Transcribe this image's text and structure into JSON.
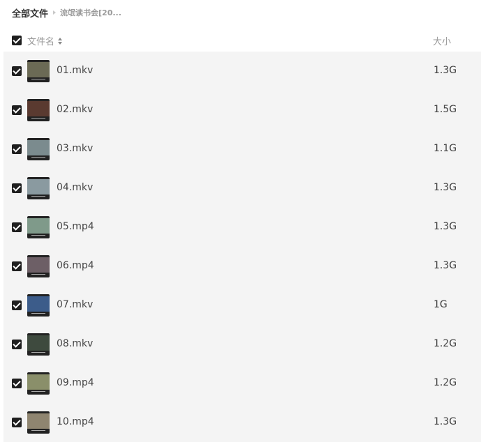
{
  "breadcrumb": {
    "root": "全部文件",
    "current": "流氓读书会[20..."
  },
  "header": {
    "name_label": "文件名",
    "size_label": "大小",
    "all_checked": true
  },
  "files": [
    {
      "name": "01.mkv",
      "size": "1.3G",
      "checked": true,
      "thumb_color": "#6b6a55"
    },
    {
      "name": "02.mkv",
      "size": "1.5G",
      "checked": true,
      "thumb_color": "#5a3a30"
    },
    {
      "name": "03.mkv",
      "size": "1.1G",
      "checked": true,
      "thumb_color": "#7b8b8e"
    },
    {
      "name": "04.mkv",
      "size": "1.3G",
      "checked": true,
      "thumb_color": "#8a9aa0"
    },
    {
      "name": "05.mp4",
      "size": "1.3G",
      "checked": true,
      "thumb_color": "#7f9a8a"
    },
    {
      "name": "06.mp4",
      "size": "1.3G",
      "checked": true,
      "thumb_color": "#6d5f66"
    },
    {
      "name": "07.mkv",
      "size": "1G",
      "checked": true,
      "thumb_color": "#3c5c8a"
    },
    {
      "name": "08.mkv",
      "size": "1.2G",
      "checked": true,
      "thumb_color": "#3e4a3e"
    },
    {
      "name": "09.mp4",
      "size": "1.2G",
      "checked": true,
      "thumb_color": "#8a8f6a"
    },
    {
      "name": "10.mp4",
      "size": "1.3G",
      "checked": true,
      "thumb_color": "#8f8570"
    }
  ]
}
